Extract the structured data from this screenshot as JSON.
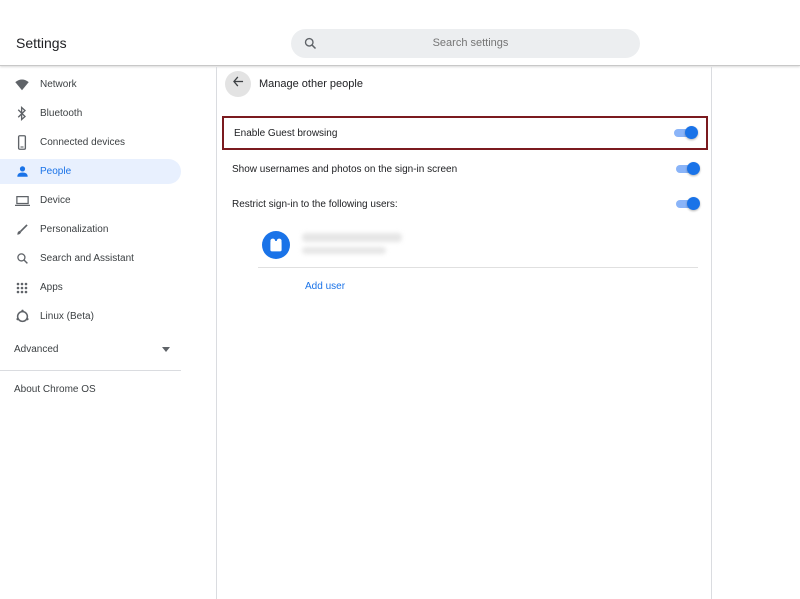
{
  "window": {
    "minimize_icon": "minimize-icon",
    "maximize_icon": "maximize-icon",
    "close_icon": "close-icon"
  },
  "header": {
    "title": "Settings",
    "search": {
      "placeholder": "Search settings",
      "icon": "search-icon"
    }
  },
  "sidebar": {
    "items": [
      {
        "label": "Network",
        "icon": "wifi-icon",
        "selected": false
      },
      {
        "label": "Bluetooth",
        "icon": "bluetooth-icon",
        "selected": false
      },
      {
        "label": "Connected devices",
        "icon": "phone-icon",
        "selected": false
      },
      {
        "label": "People",
        "icon": "person-icon",
        "selected": true
      },
      {
        "label": "Device",
        "icon": "laptop-icon",
        "selected": false
      },
      {
        "label": "Personalization",
        "icon": "brush-icon",
        "selected": false
      },
      {
        "label": "Search and Assistant",
        "icon": "search-icon",
        "selected": false
      },
      {
        "label": "Apps",
        "icon": "apps-grid-icon",
        "selected": false
      },
      {
        "label": "Linux (Beta)",
        "icon": "linux-icon",
        "selected": false
      }
    ],
    "advanced": "Advanced",
    "about": "About Chrome OS"
  },
  "main": {
    "title": "Manage other people",
    "settings": [
      {
        "label": "Enable Guest browsing",
        "enabled": true,
        "highlighted": true
      },
      {
        "label": "Show usernames and photos on the sign-in screen",
        "enabled": true,
        "highlighted": false
      },
      {
        "label": "Restrict sign-in to the following users:",
        "enabled": true,
        "highlighted": false
      }
    ],
    "add_user": "Add user"
  },
  "colors": {
    "accent": "#1a73e8",
    "selected_bg": "#e8f0fe",
    "highlight_border": "#7b1a1f"
  }
}
